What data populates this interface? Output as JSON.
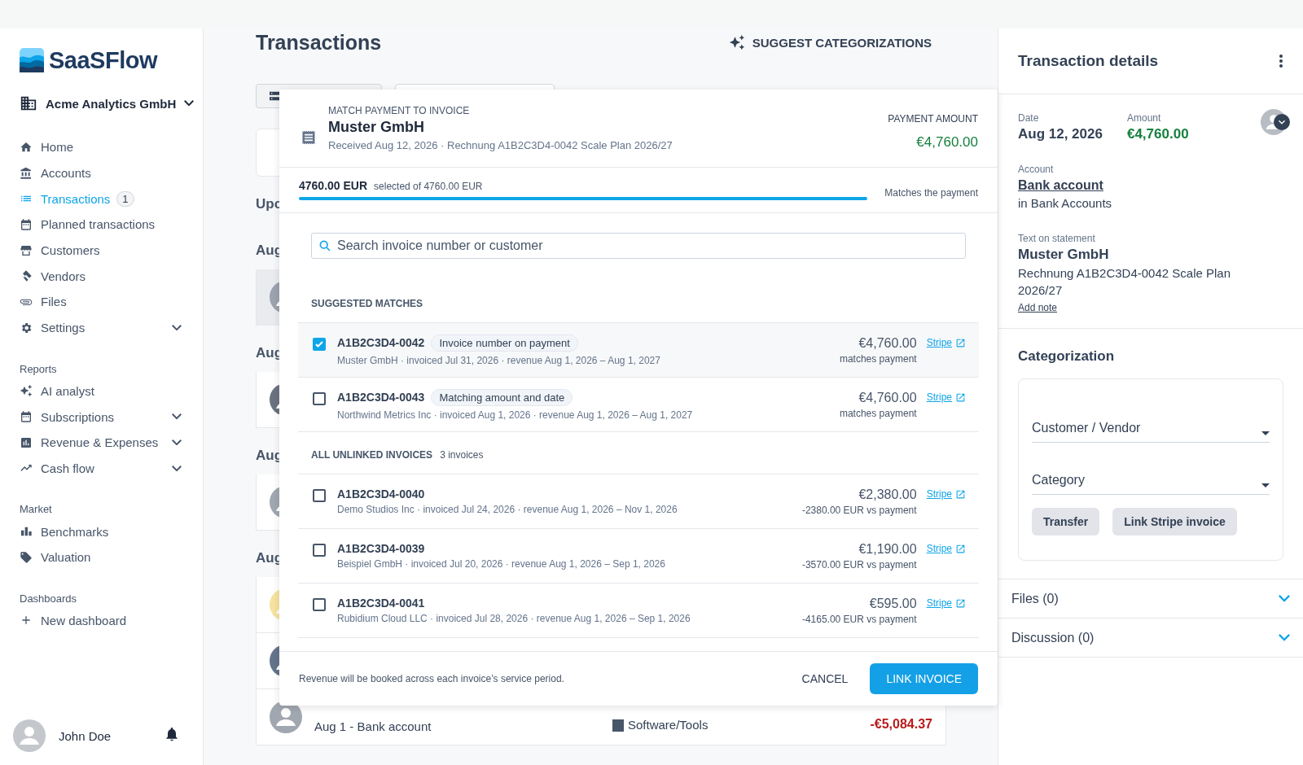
{
  "sidebar": {
    "logo": "SaaSFlow",
    "org": "Acme Analytics GmbH",
    "groups": [
      {
        "items": [
          {
            "label": "Home",
            "selected": false,
            "submenu": false
          },
          {
            "label": "Accounts",
            "selected": false,
            "submenu": false
          },
          {
            "label": "Transactions",
            "selected": true,
            "submenu": false,
            "badge": "1"
          },
          {
            "label": "Planned transactions",
            "selected": false,
            "submenu": false
          },
          {
            "label": "Customers",
            "selected": false,
            "submenu": false
          },
          {
            "label": "Vendors",
            "selected": false,
            "submenu": false
          },
          {
            "label": "Files",
            "selected": false,
            "submenu": false
          },
          {
            "label": "Settings",
            "selected": false,
            "submenu": true
          }
        ]
      },
      {
        "title": "Reports",
        "items": [
          {
            "label": "AI analyst",
            "selected": false,
            "submenu": false
          },
          {
            "label": "Subscriptions",
            "selected": false,
            "submenu": true
          },
          {
            "label": "Revenue & Expenses",
            "selected": false,
            "submenu": true
          },
          {
            "label": "Cash flow",
            "selected": false,
            "submenu": true
          }
        ]
      },
      {
        "title": "Market",
        "items": [
          {
            "label": "Benchmarks",
            "selected": false,
            "submenu": false
          },
          {
            "label": "Valuation",
            "selected": false,
            "submenu": false
          }
        ]
      },
      {
        "title": "Dashboards",
        "items": [
          {
            "label": "New dashboard",
            "selected": false,
            "submenu": false
          }
        ]
      }
    ],
    "user": {
      "name": "John Doe"
    }
  },
  "main": {
    "title": "Transactions",
    "action": "SUGGEST CATEGORIZATIONS",
    "list": [
      {
        "kind": "card"
      },
      {
        "kind": "heading",
        "text": "Upc"
      },
      {
        "kind": "heading",
        "text": "Aug"
      },
      {
        "kind": "row",
        "selected": true,
        "color": "#9ca3af"
      },
      {
        "kind": "heading",
        "text": "Aug"
      },
      {
        "kind": "row",
        "selected": false,
        "color": "#6b7280"
      },
      {
        "kind": "heading",
        "text": "Aug"
      },
      {
        "kind": "row",
        "selected": false,
        "color": "#a1a7b0"
      },
      {
        "kind": "heading",
        "text": "Aug"
      },
      {
        "kind": "row",
        "selected": false,
        "color": "#f6e3a1"
      },
      {
        "kind": "row",
        "selected": false,
        "color": "#64748b"
      },
      {
        "kind": "row",
        "selected": false,
        "color": "#a1a7b0",
        "meta": "Aug 1 - Bank account",
        "category": "Software/Tools",
        "amount": "-€5,084.37"
      }
    ]
  },
  "modal": {
    "kicker": "MATCH PAYMENT TO INVOICE",
    "title": "Muster GmbH",
    "subtitle": "Received Aug 12, 2026 · Rechnung A1B2C3D4-0042 Scale Plan 2026/27",
    "amount_label": "PAYMENT AMOUNT",
    "amount": "€4,760.00",
    "progress": {
      "selected": "4760.00 EUR",
      "of": "selected of 4760.00 EUR",
      "level": 1,
      "status": "Matches the payment"
    },
    "search": {
      "placeholder": "Search invoice number or customer"
    },
    "sections": [
      {
        "title": "SUGGESTED MATCHES",
        "invoices": [
          {
            "number": "A1B2C3D4-0042",
            "reason": "Invoice number on payment",
            "details": "Muster GmbH · invoiced Jul 31, 2026 · revenue Aug 1, 2026 – Aug 1, 2027",
            "amount": "€4,760.00",
            "note": "matches payment",
            "link": "Stripe",
            "checked": true
          },
          {
            "number": "A1B2C3D4-0043",
            "reason": "Matching amount and date",
            "details": "Northwind Metrics Inc · invoiced Aug 1, 2026 · revenue Aug 1, 2026 – Aug 1, 2027",
            "amount": "€4,760.00",
            "note": "matches payment",
            "link": "Stripe",
            "checked": false
          }
        ]
      },
      {
        "title": "ALL UNLINKED INVOICES",
        "count": "3 invoices",
        "invoices": [
          {
            "number": "A1B2C3D4-0040",
            "details": "Demo Studios Inc · invoiced Jul 24, 2026 · revenue Aug 1, 2026 – Nov 1, 2026",
            "amount": "€2,380.00",
            "note": "-2380.00 EUR vs payment",
            "link": "Stripe",
            "checked": false
          },
          {
            "number": "A1B2C3D4-0039",
            "details": "Beispiel GmbH · invoiced Jul 20, 2026 · revenue Aug 1, 2026 – Sep 1, 2026",
            "amount": "€1,190.00",
            "note": "-3570.00 EUR vs payment",
            "link": "Stripe",
            "checked": false
          },
          {
            "number": "A1B2C3D4-0041",
            "details": "Rubidium Cloud LLC · invoiced Jul 28, 2026 · revenue Aug 1, 2026 – Sep 1, 2026",
            "amount": "€595.00",
            "note": "-4165.00 EUR vs payment",
            "link": "Stripe",
            "checked": false
          }
        ]
      }
    ],
    "footer_note": "Revenue will be booked across each invoice’s service period.",
    "cancel": "CANCEL",
    "confirm": "LINK INVOICE"
  },
  "details": {
    "title": "Transaction details",
    "date_label": "Date",
    "date": "Aug 12, 2026",
    "amount_label": "Amount",
    "amount": "€4,760.00",
    "account_label": "Account",
    "account": "Bank account",
    "account_sub": "in Bank Accounts",
    "statement_label": "Text on statement",
    "statement_title": "Muster GmbH",
    "statement_text": "Rechnung A1B2C3D4-0042 Scale Plan 2026/27",
    "add_note": "Add note",
    "categorization": {
      "title": "Categorization",
      "fields": [
        {
          "label": "Customer / Vendor"
        },
        {
          "label": "Category"
        }
      ],
      "buttons": [
        "Transfer",
        "Link Stripe invoice"
      ]
    },
    "accordions": [
      {
        "label": "Files (0)",
        "expanded": false
      },
      {
        "label": "Discussion (0)",
        "expanded": false
      }
    ]
  }
}
